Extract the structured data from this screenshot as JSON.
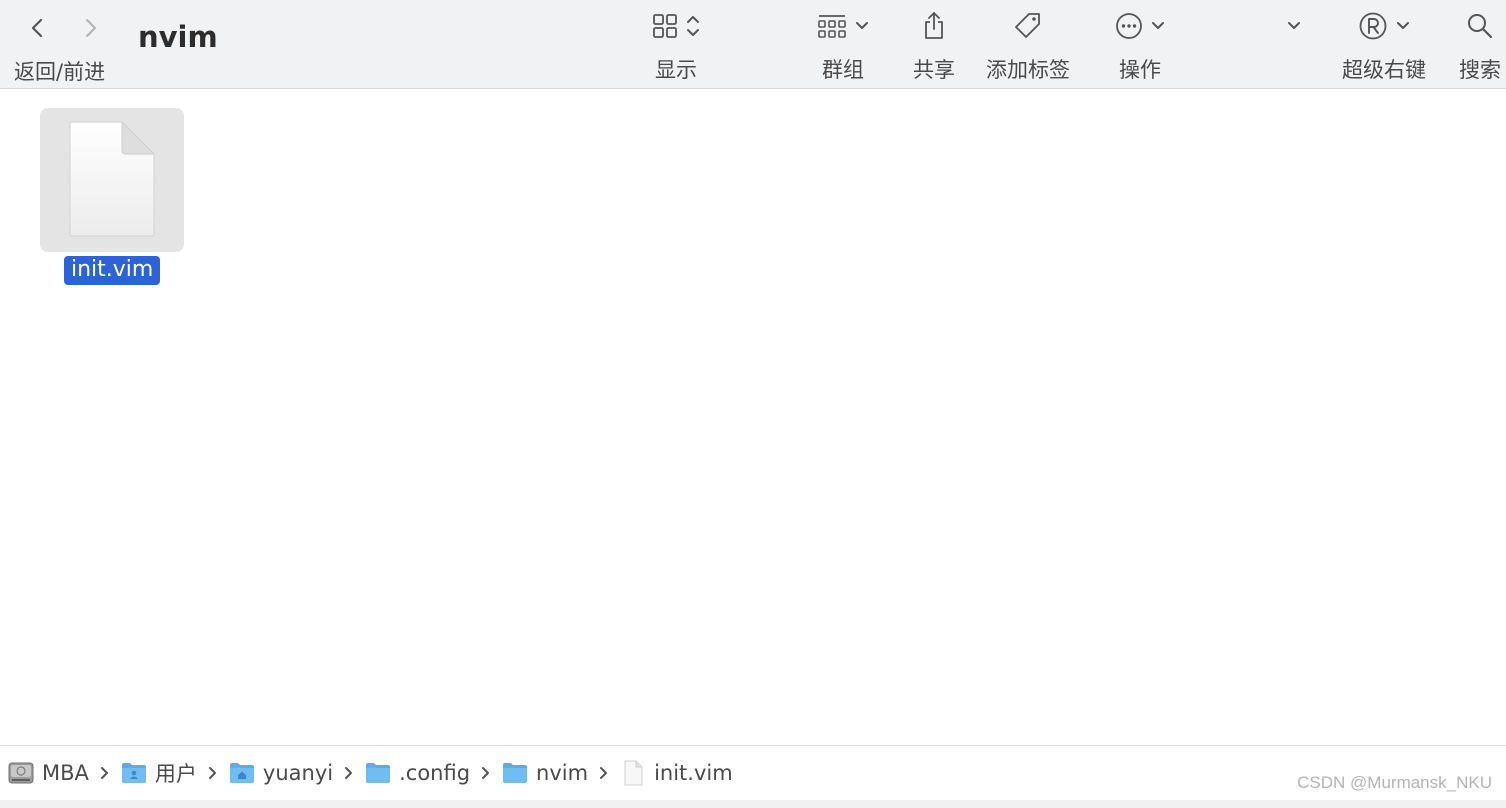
{
  "toolbar": {
    "nav_label": "返回/前进",
    "window_title": "nvim",
    "view_label": "显示",
    "group_label": "群组",
    "share_label": "共享",
    "tags_label": "添加标签",
    "action_label": "操作",
    "superkey_label": "超级右键",
    "search_label": "搜索",
    "icons": {
      "back": "chevron-left-icon",
      "forward": "chevron-right-icon",
      "view": "grid-icon",
      "group": "group-grid-icon",
      "share": "share-icon",
      "tags": "tag-icon",
      "action": "ellipsis-circle-icon",
      "superkey": "registered-icon",
      "search": "magnifier-icon"
    }
  },
  "content": {
    "files": [
      {
        "name": "init.vim",
        "selected": true,
        "icon": "document-icon"
      }
    ]
  },
  "pathbar": {
    "items": [
      {
        "label": "MBA",
        "icon": "hard-drive-icon"
      },
      {
        "label": "用户",
        "icon": "users-folder-icon"
      },
      {
        "label": "yuanyi",
        "icon": "home-folder-icon"
      },
      {
        "label": ".config",
        "icon": "folder-icon"
      },
      {
        "label": "nvim",
        "icon": "folder-icon"
      },
      {
        "label": "init.vim",
        "icon": "document-icon"
      }
    ]
  },
  "watermark": "CSDN @Murmansk_NKU",
  "colors": {
    "toolbar_bg": "#f1f2f4",
    "selection": "#2d63d8",
    "folder_blue": "#5aaee8"
  }
}
